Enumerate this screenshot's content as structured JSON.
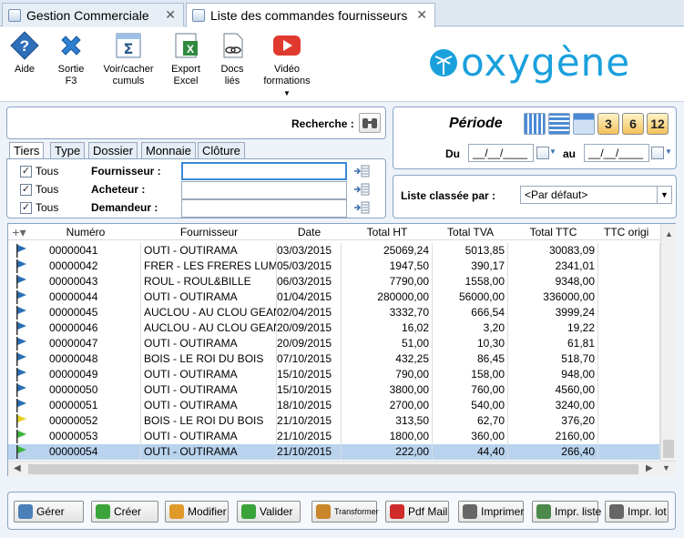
{
  "tabs": [
    {
      "label": "Gestion Commerciale"
    },
    {
      "label": "Liste des commandes fournisseurs"
    }
  ],
  "toolbar": {
    "aide": "Aide",
    "sortie": "Sortie",
    "sortie_key": "F3",
    "cumuls": "Voir/cacher",
    "cumuls2": "cumuls",
    "export": "Export",
    "export2": "Excel",
    "docs": "Docs",
    "docs2": "liés",
    "video": "Vidéo",
    "video2": "formations",
    "logo": "oxygène",
    "colors": {
      "logo": "#1aa0dc",
      "aide": "#2e6fba",
      "sortie": "#2f7fd0",
      "video": "#e03a2e"
    }
  },
  "search": {
    "label": "Recherche :"
  },
  "filters": {
    "tabs": [
      "Tiers",
      "Type",
      "Dossier",
      "Monnaie",
      "Clôture"
    ],
    "rows": [
      {
        "check_label": "Tous",
        "checked": true,
        "field_label": "Fournisseur :",
        "value": ""
      },
      {
        "check_label": "Tous",
        "checked": true,
        "field_label": "Acheteur :",
        "value": ""
      },
      {
        "check_label": "Tous",
        "checked": true,
        "field_label": "Demandeur :",
        "value": ""
      }
    ]
  },
  "periode": {
    "title": "Période",
    "du_label": "Du",
    "au_label": "au",
    "du_value": "__/__/____",
    "au_value": "__/__/____",
    "quick_buttons": [
      "3",
      "6",
      "12"
    ]
  },
  "sort": {
    "label": "Liste classée par :",
    "value": "<Par défaut>"
  },
  "grid": {
    "columns": [
      "Numéro",
      "Fournisseur",
      "Date",
      "Total HT",
      "Total TVA",
      "Total TTC",
      "TTC origi"
    ],
    "rows": [
      {
        "flag": "blue",
        "numero": "00000041",
        "fournisseur": "OUTI - OUTIRAMA",
        "date": "03/03/2015",
        "ht": "25069,24",
        "tva": "5013,85",
        "ttc": "30083,09"
      },
      {
        "flag": "blue",
        "numero": "00000042",
        "fournisseur": "FRER - LES FRERES LUMI",
        "date": "05/03/2015",
        "ht": "1947,50",
        "tva": "390,17",
        "ttc": "2341,01"
      },
      {
        "flag": "blue",
        "numero": "00000043",
        "fournisseur": "ROUL - ROUL&BILLE",
        "date": "06/03/2015",
        "ht": "7790,00",
        "tva": "1558,00",
        "ttc": "9348,00"
      },
      {
        "flag": "blue",
        "numero": "00000044",
        "fournisseur": "OUTI - OUTIRAMA",
        "date": "01/04/2015",
        "ht": "280000,00",
        "tva": "56000,00",
        "ttc": "336000,00"
      },
      {
        "flag": "blue",
        "numero": "00000045",
        "fournisseur": "AUCLOU - AU CLOU GEANT",
        "date": "02/04/2015",
        "ht": "3332,70",
        "tva": "666,54",
        "ttc": "3999,24"
      },
      {
        "flag": "blue",
        "numero": "00000046",
        "fournisseur": "AUCLOU - AU CLOU GEANT",
        "date": "20/09/2015",
        "ht": "16,02",
        "tva": "3,20",
        "ttc": "19,22"
      },
      {
        "flag": "blue",
        "numero": "00000047",
        "fournisseur": "OUTI - OUTIRAMA",
        "date": "20/09/2015",
        "ht": "51,00",
        "tva": "10,30",
        "ttc": "61,81"
      },
      {
        "flag": "blue",
        "numero": "00000048",
        "fournisseur": "BOIS - LE ROI DU BOIS",
        "date": "07/10/2015",
        "ht": "432,25",
        "tva": "86,45",
        "ttc": "518,70"
      },
      {
        "flag": "blue",
        "numero": "00000049",
        "fournisseur": "OUTI - OUTIRAMA",
        "date": "15/10/2015",
        "ht": "790,00",
        "tva": "158,00",
        "ttc": "948,00"
      },
      {
        "flag": "blue",
        "numero": "00000050",
        "fournisseur": "OUTI - OUTIRAMA",
        "date": "15/10/2015",
        "ht": "3800,00",
        "tva": "760,00",
        "ttc": "4560,00"
      },
      {
        "flag": "blue",
        "numero": "00000051",
        "fournisseur": "OUTI - OUTIRAMA",
        "date": "18/10/2015",
        "ht": "2700,00",
        "tva": "540,00",
        "ttc": "3240,00"
      },
      {
        "flag": "yellow",
        "numero": "00000052",
        "fournisseur": "BOIS - LE ROI DU BOIS",
        "date": "21/10/2015",
        "ht": "313,50",
        "tva": "62,70",
        "ttc": "376,20"
      },
      {
        "flag": "green",
        "numero": "00000053",
        "fournisseur": "OUTI - OUTIRAMA",
        "date": "21/10/2015",
        "ht": "1800,00",
        "tva": "360,00",
        "ttc": "2160,00"
      },
      {
        "flag": "green",
        "numero": "00000054",
        "fournisseur": "OUTI - OUTIRAMA",
        "date": "21/10/2015",
        "ht": "222,00",
        "tva": "44,40",
        "ttc": "266,40",
        "selected": true
      }
    ],
    "flag_colors": {
      "blue": "#2a6fb5",
      "yellow": "#e8d320",
      "green": "#3bb53b"
    }
  },
  "buttons": [
    {
      "label": "Gérer",
      "icon": "gear-icon",
      "color": "#4a7fb8"
    },
    {
      "label": "Créer",
      "icon": "plus-icon",
      "color": "#3aa43a"
    },
    {
      "label": "Modifier",
      "icon": "pencil-icon",
      "color": "#e09a2a"
    },
    {
      "label": "Valider",
      "icon": "check-icon",
      "color": "#3aa43a"
    },
    {
      "label": "Transformer",
      "icon": "transform-icon",
      "color": "#c9862a"
    },
    {
      "label": "Pdf Mail",
      "icon": "pdf-icon",
      "color": "#d02b2b"
    },
    {
      "label": "Imprimer",
      "icon": "printer-icon",
      "color": "#666666"
    },
    {
      "label": "Impr. liste",
      "icon": "printer-list-icon",
      "color": "#4b8a4b"
    },
    {
      "label": "Impr. lot",
      "icon": "printer-lot-icon",
      "color": "#666666"
    }
  ]
}
